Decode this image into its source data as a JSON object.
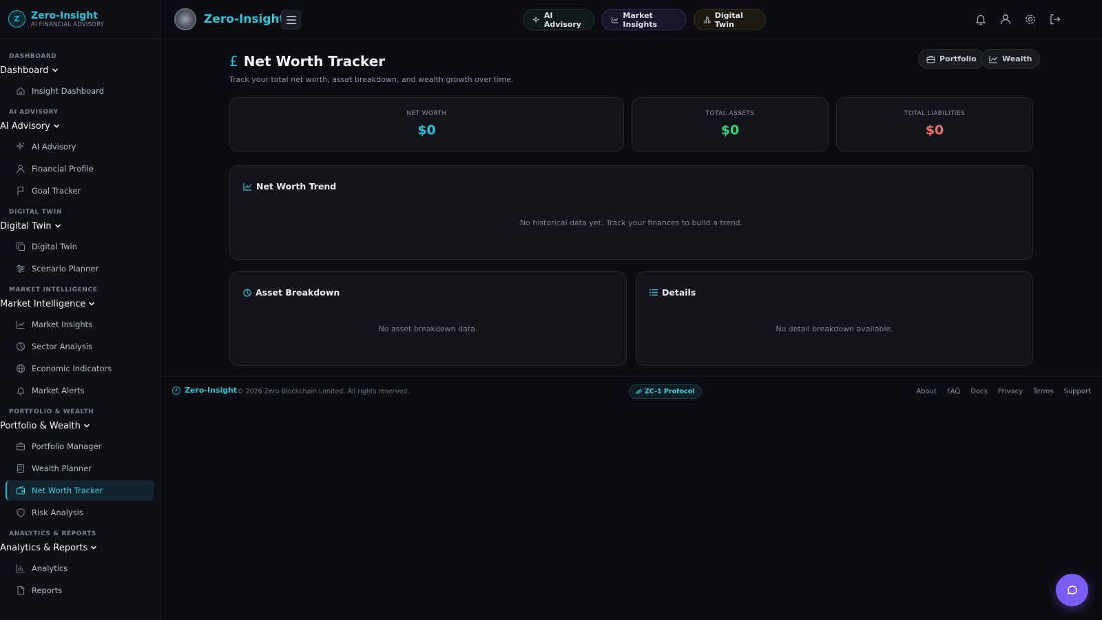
{
  "brand": {
    "name": "Zero-Insight",
    "subtitle": "AI FINANCIAL ADVISORY",
    "logo_letter": "Z"
  },
  "sidebar": {
    "sections": [
      {
        "label": "DASHBOARD",
        "group": "Dashboard",
        "items": [
          {
            "label": "Insight Dashboard",
            "icon": "home-icon"
          }
        ]
      },
      {
        "label": "AI ADVISORY",
        "group": "AI Advisory",
        "items": [
          {
            "label": "AI Advisory",
            "icon": "sparkles-icon"
          },
          {
            "label": "Financial Profile",
            "icon": "user-icon"
          },
          {
            "label": "Goal Tracker",
            "icon": "flag-icon"
          }
        ]
      },
      {
        "label": "DIGITAL TWIN",
        "group": "Digital Twin",
        "items": [
          {
            "label": "Digital Twin",
            "icon": "copy-icon"
          },
          {
            "label": "Scenario Planner",
            "icon": "sliders-icon"
          }
        ]
      },
      {
        "label": "MARKET INTELLIGENCE",
        "group": "Market Intelligence",
        "items": [
          {
            "label": "Market Insights",
            "icon": "trend-icon"
          },
          {
            "label": "Sector Analysis",
            "icon": "pie-icon"
          },
          {
            "label": "Economic Indicators",
            "icon": "globe-icon"
          },
          {
            "label": "Market Alerts",
            "icon": "bell-icon"
          }
        ]
      },
      {
        "label": "PORTFOLIO & WEALTH",
        "group": "Portfolio & Wealth",
        "items": [
          {
            "label": "Portfolio Manager",
            "icon": "briefcase-icon"
          },
          {
            "label": "Wealth Planner",
            "icon": "calculator-icon"
          },
          {
            "label": "Net Worth Tracker",
            "icon": "wallet-icon",
            "active": true
          },
          {
            "label": "Risk Analysis",
            "icon": "shield-icon"
          }
        ]
      },
      {
        "label": "ANALYTICS & REPORTS",
        "group": "Analytics & Reports",
        "items": [
          {
            "label": "Analytics",
            "icon": "bar-chart-icon"
          },
          {
            "label": "Reports",
            "icon": "file-icon"
          }
        ]
      }
    ]
  },
  "topbar": {
    "title": "Zero-Insight",
    "pills": {
      "ai": "AI Advisory",
      "market": "Market Insights",
      "twin": "Digital Twin"
    }
  },
  "page": {
    "title": "Net Worth Tracker",
    "title_icon": "£",
    "subtitle": "Track your total net worth, asset breakdown, and wealth growth over time.",
    "buttons": {
      "portfolio": "Portfolio",
      "wealth": "Wealth"
    }
  },
  "stats": {
    "net_worth": {
      "label": "NET WORTH",
      "value": "$0",
      "color": "#22c3d6"
    },
    "total_assets": {
      "label": "TOTAL ASSETS",
      "value": "$0",
      "color": "#2fd47a"
    },
    "total_liabilities": {
      "label": "TOTAL LIABILITIES",
      "value": "$0",
      "color": "#f26d6d"
    }
  },
  "trend": {
    "title": "Net Worth Trend",
    "empty": "No historical data yet. Track your finances to build a trend."
  },
  "breakdown": {
    "title": "Asset Breakdown",
    "empty": "No asset breakdown data."
  },
  "details": {
    "title": "Details",
    "empty": "No detail breakdown available."
  },
  "footer": {
    "brand": "Zero-Insight",
    "copyright": "© 2026 Zero Blockchain Limited. All rights reserved.",
    "protocol": "ZC-1 Protocol",
    "links": [
      "About",
      "FAQ",
      "Docs",
      "Privacy",
      "Terms",
      "Support"
    ]
  },
  "colors": {
    "accent": "#22c3d6",
    "chat_button": "#7b5cf5"
  }
}
